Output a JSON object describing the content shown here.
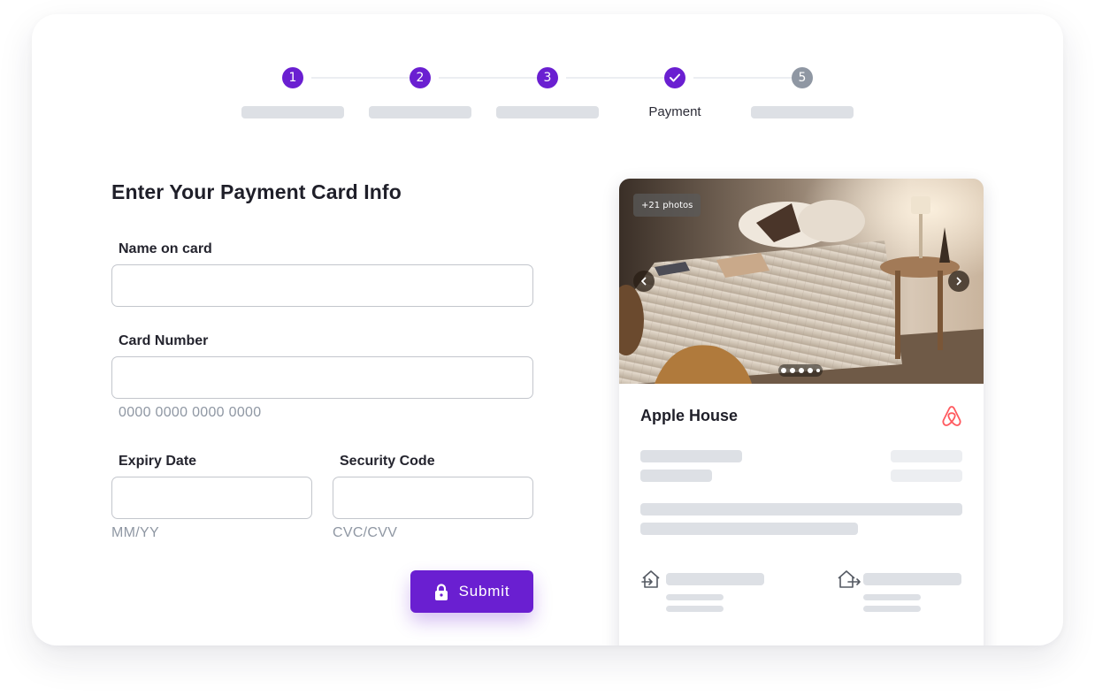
{
  "stepper": {
    "steps": [
      {
        "number": "1",
        "state": "done",
        "label": ""
      },
      {
        "number": "2",
        "state": "done",
        "label": ""
      },
      {
        "number": "3",
        "state": "done",
        "label": ""
      },
      {
        "number": "",
        "state": "current",
        "label": "Payment"
      },
      {
        "number": "5",
        "state": "upcoming",
        "label": ""
      }
    ]
  },
  "form": {
    "title": "Enter Your Payment Card Info",
    "name_label": "Name on card",
    "name_value": "",
    "card_label": "Card Number",
    "card_value": "",
    "card_hint": "0000 0000 0000 0000",
    "expiry_label": "Expiry Date",
    "expiry_value": "",
    "expiry_hint": "MM/YY",
    "security_label": "Security Code",
    "security_value": "",
    "security_hint": "CVC/CVV",
    "submit_label": "Submit"
  },
  "listing": {
    "photo_badge": "+21 photos",
    "title": "Apple House",
    "brand_icon": "airbnb-logo-icon",
    "brand_color": "#ff5a5f"
  },
  "colors": {
    "accent": "#6a1fd1",
    "upcoming_step": "#8f97a3",
    "placeholder_bar": "#dde0e5"
  }
}
